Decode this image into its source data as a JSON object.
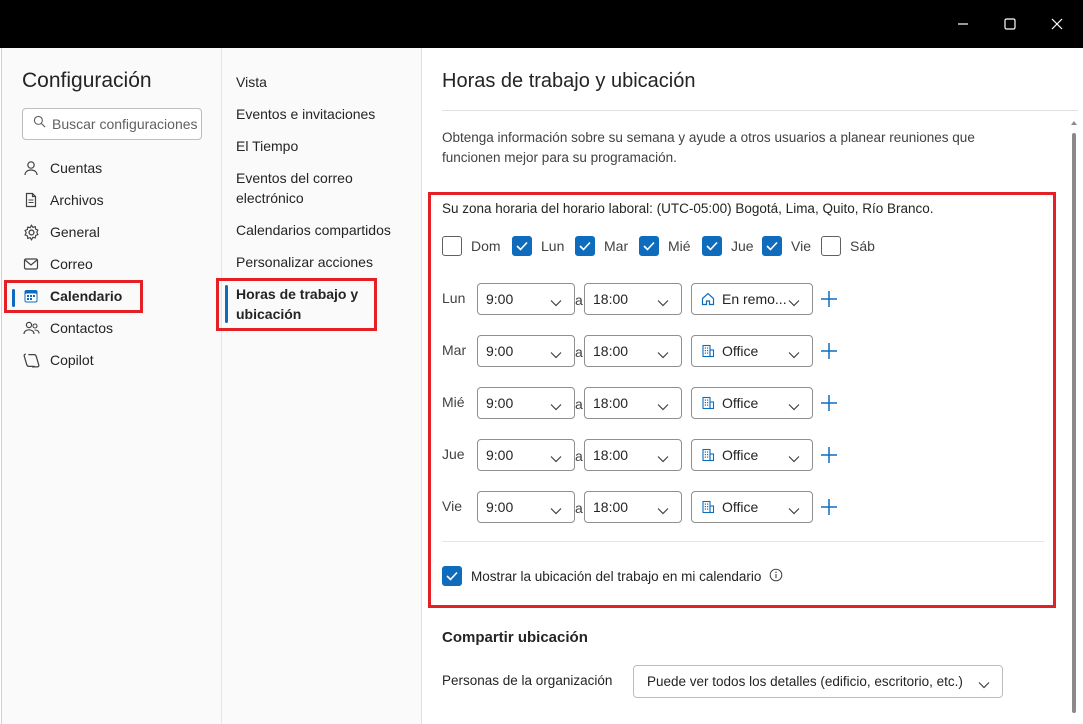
{
  "window": {
    "controls": {
      "minimize": "minimize-icon",
      "maximize": "maximize-icon",
      "close": "close-icon"
    }
  },
  "settings": {
    "title": "Configuración",
    "search_placeholder": "Buscar configuraciones",
    "nav": [
      {
        "label": "Cuentas",
        "icon": "person-icon"
      },
      {
        "label": "Archivos",
        "icon": "document-icon"
      },
      {
        "label": "General",
        "icon": "gear-icon"
      },
      {
        "label": "Correo",
        "icon": "mail-icon"
      },
      {
        "label": "Calendario",
        "icon": "calendar-icon",
        "active": true
      },
      {
        "label": "Contactos",
        "icon": "people-icon"
      },
      {
        "label": "Copilot",
        "icon": "copilot-icon"
      }
    ]
  },
  "calendar_menu": [
    {
      "label": "Vista"
    },
    {
      "label": "Eventos e invitaciones"
    },
    {
      "label": "El Tiempo"
    },
    {
      "label": "Eventos del correo electrónico"
    },
    {
      "label": "Calendarios compartidos"
    },
    {
      "label": "Personalizar acciones"
    },
    {
      "label": "Horas de trabajo y ubicación",
      "active": true
    }
  ],
  "main": {
    "title": "Horas de trabajo y ubicación",
    "description": "Obtenga información sobre su semana y ayude a otros usuarios a planear reuniones que funcionen mejor para su programación.",
    "timezone": "Su zona horaria del horario laboral: (UTC-05:00) Bogotá, Lima, Quito, Río Branco.",
    "days": [
      {
        "label": "Dom",
        "checked": false
      },
      {
        "label": "Lun",
        "checked": true
      },
      {
        "label": "Mar",
        "checked": true
      },
      {
        "label": "Mié",
        "checked": true
      },
      {
        "label": "Jue",
        "checked": true
      },
      {
        "label": "Vie",
        "checked": true
      },
      {
        "label": "Sáb",
        "checked": false
      }
    ],
    "separator": "a",
    "schedule": [
      {
        "day": "Lun",
        "start": "9:00",
        "end": "18:00",
        "location": "En remo...",
        "location_icon": "home-icon"
      },
      {
        "day": "Mar",
        "start": "9:00",
        "end": "18:00",
        "location": "Office",
        "location_icon": "building-icon"
      },
      {
        "day": "Mié",
        "start": "9:00",
        "end": "18:00",
        "location": "Office",
        "location_icon": "building-icon"
      },
      {
        "day": "Jue",
        "start": "9:00",
        "end": "18:00",
        "location": "Office",
        "location_icon": "building-icon"
      },
      {
        "day": "Vie",
        "start": "9:00",
        "end": "18:00",
        "location": "Office",
        "location_icon": "building-icon"
      }
    ],
    "show_location": {
      "label": "Mostrar la ubicación del trabajo en mi calendario",
      "checked": true
    },
    "share": {
      "title": "Compartir ubicación",
      "org_label": "Personas de la organización",
      "org_value": "Puede ver todos los detalles (edificio, escritorio, etc.)"
    }
  },
  "colors": {
    "accent": "#0f6cbd",
    "highlight": "#e41f26",
    "titlebar": "#000000"
  }
}
